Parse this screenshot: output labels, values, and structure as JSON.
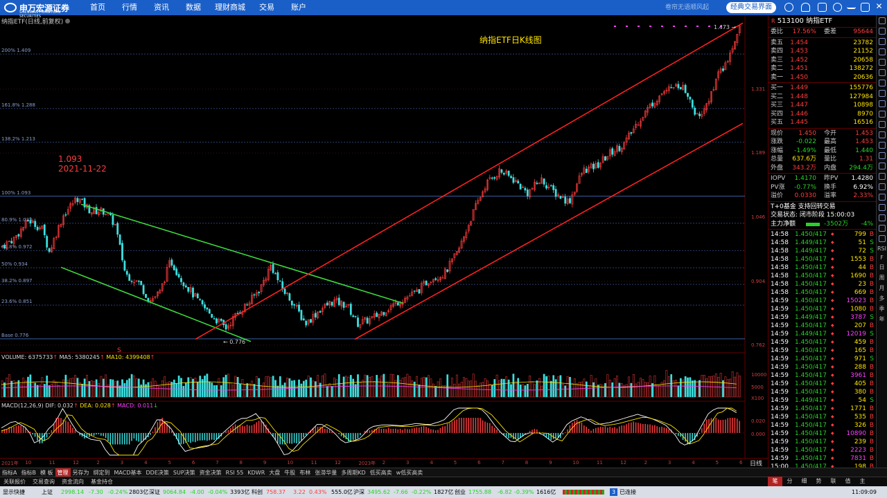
{
  "topbar": {
    "logo_cn": "申万宏源证券",
    "logo_en": "SHENWAN HONGYUAN SECURITIES",
    "nav": [
      "首页",
      "行情",
      "资讯",
      "数据",
      "理财商城",
      "交易",
      "账户"
    ],
    "news_text": "卷帘无语顺风起",
    "classic_btn": "经典交易界面"
  },
  "chart": {
    "title": "纳指ETF(日线,前复权)",
    "heading": "纳指ETF日K线图",
    "anno_price": "1.093",
    "anno_date": "2021-11-22",
    "low_label": "← 0.776",
    "high_label": "1.473 →",
    "fib_levels": [
      {
        "label": "200% 1.409",
        "price": 1.409
      },
      {
        "label": "161.8% 1.288",
        "price": 1.288
      },
      {
        "label": "138.2% 1.213",
        "price": 1.213
      },
      {
        "label": "100% 1.093",
        "price": 1.093
      },
      {
        "label": "80.9% 1.033",
        "price": 1.033
      },
      {
        "label": "61.8% 0.972",
        "price": 0.972
      },
      {
        "label": "50% 0.934",
        "price": 0.934
      },
      {
        "label": "38.2% 0.897",
        "price": 0.897
      },
      {
        "label": "23.6% 0.851",
        "price": 0.851
      },
      {
        "label": "Base 0.776",
        "price": 0.776
      }
    ],
    "price_axis": [
      "1.331",
      "1.189",
      "1.046",
      "0.904",
      "0.762"
    ],
    "volume_legend": {
      "vol": "VOLUME: 6375733",
      "ma5": "MA5: 5380245",
      "ma10": "MA10: 4399408"
    },
    "volume_axis": [
      "10000",
      "5000",
      "X100"
    ],
    "macd_legend": {
      "name": "MACD(12,26,9)",
      "dif": "DIF: 0.032",
      "dea": "DEA: 0.028",
      "macd": "MACD: 0.011"
    },
    "macd_axis": [
      "0.020",
      "0.000"
    ],
    "time_ticks": [
      "2021年",
      "10",
      "11",
      "12",
      "2",
      "3",
      "4",
      "5",
      "6",
      "7",
      "8",
      "9",
      "10",
      "11",
      "12",
      "2023年",
      "2",
      "3",
      "4",
      "5",
      "6",
      "7",
      "8",
      "9",
      "10",
      "11",
      "12",
      "2",
      "3",
      "4",
      "5",
      "6"
    ],
    "period": "日线"
  },
  "quote": {
    "code": "513100",
    "name": "纳指ETF",
    "weibi_label": "委比",
    "weibi": "17.56%",
    "weicha_label": "委差",
    "weicha": "95644",
    "asks": [
      {
        "label": "卖五",
        "price": "1.454",
        "vol": "23782"
      },
      {
        "label": "卖四",
        "price": "1.453",
        "vol": "21152"
      },
      {
        "label": "卖三",
        "price": "1.452",
        "vol": "20658"
      },
      {
        "label": "卖二",
        "price": "1.451",
        "vol": "138272"
      },
      {
        "label": "卖一",
        "price": "1.450",
        "vol": "20636"
      }
    ],
    "bids": [
      {
        "label": "买一",
        "price": "1.449",
        "vol": "155776"
      },
      {
        "label": "买二",
        "price": "1.448",
        "vol": "127984"
      },
      {
        "label": "买三",
        "price": "1.447",
        "vol": "10898"
      },
      {
        "label": "买四",
        "price": "1.446",
        "vol": "8970"
      },
      {
        "label": "买五",
        "price": "1.445",
        "vol": "16516"
      }
    ],
    "stats": [
      {
        "l1": "现价",
        "v1": "1.450",
        "c1": "red",
        "l2": "今开",
        "v2": "1.453",
        "c2": "red"
      },
      {
        "l1": "涨跌",
        "v1": "-0.022",
        "c1": "green",
        "l2": "最高",
        "v2": "1.453",
        "c2": "red"
      },
      {
        "l1": "涨幅",
        "v1": "-1.49%",
        "c1": "green",
        "l2": "最低",
        "v2": "1.440",
        "c2": "green"
      },
      {
        "l1": "总量",
        "v1": "637.6万",
        "c1": "yellow",
        "l2": "量比",
        "v2": "1.31",
        "c2": "red"
      },
      {
        "l1": "外盘",
        "v1": "343.2万",
        "c1": "red",
        "l2": "内盘",
        "v2": "294.4万",
        "c2": "green"
      }
    ],
    "iopv": [
      {
        "l1": "IOPV",
        "v1": "1.4170",
        "c1": "green",
        "l2": "昨PV",
        "v2": "1.4280",
        "c2": "white"
      },
      {
        "l1": "PV涨",
        "v1": "-0.77%",
        "c1": "green",
        "l2": "换手",
        "v2": "6.92%",
        "c2": "white"
      },
      {
        "l1": "溢价",
        "v1": "0.0330",
        "c1": "red",
        "l2": "溢率",
        "v2": "2.33%",
        "c2": "red"
      }
    ],
    "t0": "T+0基金 支持回转交易",
    "trade_status": "交易状态: 闭市阶段 15:00:03",
    "main_fund_label": "主力净额",
    "main_fund_value": "-3502万",
    "main_fund_pct": "-4%"
  },
  "ticks": [
    {
      "t": "14:58",
      "p": "1.450/417",
      "v": "799",
      "d": "B"
    },
    {
      "t": "14:58",
      "p": "1.449/417",
      "v": "51",
      "d": "S"
    },
    {
      "t": "14:58",
      "p": "1.449/417",
      "v": "72",
      "d": "S"
    },
    {
      "t": "14:58",
      "p": "1.450/417",
      "v": "1553",
      "d": "B"
    },
    {
      "t": "14:58",
      "p": "1.450/417",
      "v": "44",
      "d": "B"
    },
    {
      "t": "14:58",
      "p": "1.450/417",
      "v": "1690",
      "d": "B"
    },
    {
      "t": "14:58",
      "p": "1.450/417",
      "v": "23",
      "d": "B"
    },
    {
      "t": "14:58",
      "p": "1.450/417",
      "v": "669",
      "d": "B"
    },
    {
      "t": "14:59",
      "p": "1.450/417",
      "v": "15023",
      "d": "B"
    },
    {
      "t": "14:59",
      "p": "1.450/417",
      "v": "1080",
      "d": "B"
    },
    {
      "t": "14:59",
      "p": "1.449/417",
      "v": "3787",
      "d": "S"
    },
    {
      "t": "14:59",
      "p": "1.450/417",
      "v": "207",
      "d": "B"
    },
    {
      "t": "14:59",
      "p": "1.449/417",
      "v": "12019",
      "d": "S"
    },
    {
      "t": "14:59",
      "p": "1.450/417",
      "v": "459",
      "d": "B"
    },
    {
      "t": "14:59",
      "p": "1.450/417",
      "v": "165",
      "d": "B"
    },
    {
      "t": "14:59",
      "p": "1.450/417",
      "v": "971",
      "d": "S"
    },
    {
      "t": "14:59",
      "p": "1.450/417",
      "v": "288",
      "d": "B"
    },
    {
      "t": "14:59",
      "p": "1.450/417",
      "v": "3961",
      "d": "B"
    },
    {
      "t": "14:59",
      "p": "1.450/417",
      "v": "405",
      "d": "B"
    },
    {
      "t": "14:59",
      "p": "1.450/417",
      "v": "380",
      "d": "B"
    },
    {
      "t": "14:59",
      "p": "1.449/417",
      "v": "54",
      "d": "S"
    },
    {
      "t": "14:59",
      "p": "1.450/417",
      "v": "1771",
      "d": "B"
    },
    {
      "t": "14:59",
      "p": "1.450/417",
      "v": "535",
      "d": "B"
    },
    {
      "t": "14:59",
      "p": "1.450/417",
      "v": "326",
      "d": "B"
    },
    {
      "t": "14:59",
      "p": "1.450/417",
      "v": "10890",
      "d": "B"
    },
    {
      "t": "14:59",
      "p": "1.450/417",
      "v": "239",
      "d": "B"
    },
    {
      "t": "14:59",
      "p": "1.450/417",
      "v": "2223",
      "d": "B"
    },
    {
      "t": "14:59",
      "p": "1.450/417",
      "v": "7831",
      "d": "B"
    },
    {
      "t": "15:00",
      "p": "1.450/417",
      "v": "198",
      "d": "B"
    }
  ],
  "tabs1": [
    "指标A",
    "指标B",
    "模 板",
    "管理",
    "另存为",
    "绑定到",
    "MACD基本",
    "DDE决策",
    "SUP决策",
    "资金决策",
    "RSI 55",
    "KDWR",
    "大盘",
    "牛股",
    "布林",
    "张滞华量",
    "多周期KD",
    "低买高卖",
    "w低买高卖"
  ],
  "tabs1_active": "管理",
  "tabs2": [
    "关联报价",
    "交易查询",
    "资金流向",
    "基金持仓"
  ],
  "rtabs": [
    "笔",
    "分",
    "细",
    "势",
    "联",
    "值",
    "主"
  ],
  "rtabs_active": "笔",
  "icon_labels": [
    "RSI",
    "F",
    "日",
    "周",
    "月",
    "多",
    "季",
    "年"
  ],
  "status": {
    "show_label": "显示快捷",
    "sh_label": "上证",
    "sh": "2998.14",
    "sh_chg": "-7.30",
    "sh_pct": "-0.24%",
    "sh_amt": "2803亿",
    "sz_label": "深证",
    "sz": "9064.84",
    "sz_chg": "-4.00",
    "sz_pct": "-0.04%",
    "sz_amt": "3393亿",
    "kc_label": "科创",
    "kc": "758.37",
    "kc_chg": "3.22",
    "kc_pct": "0.43%",
    "kc_amt": "555.0亿",
    "hs_label": "沪深",
    "hs": "3495.62",
    "hs_chg": "-7.66",
    "hs_pct": "-0.22%",
    "hs_amt": "1827亿",
    "cy_label": "创业",
    "cy": "1755.88",
    "cy_chg": "-6.82",
    "cy_pct": "-0.39%",
    "cy_amt": "1616亿",
    "conn_num": "3",
    "conn_label": "已连接",
    "time": "11:09:09"
  },
  "chart_data": {
    "type": "candlestick",
    "title": "纳指ETF日K线图",
    "ylim": [
      0.762,
      1.473
    ],
    "close_path": [
      [
        0,
        0.98
      ],
      [
        20,
        1.0
      ],
      [
        40,
        1.04
      ],
      [
        60,
        1.02
      ],
      [
        70,
        0.97
      ],
      [
        90,
        1.05
      ],
      [
        110,
        1.09
      ],
      [
        130,
        1.06
      ],
      [
        150,
        1.06
      ],
      [
        165,
        1.03
      ],
      [
        180,
        0.92
      ],
      [
        200,
        0.9
      ],
      [
        215,
        0.86
      ],
      [
        230,
        0.88
      ],
      [
        245,
        0.95
      ],
      [
        260,
        0.91
      ],
      [
        275,
        0.88
      ],
      [
        290,
        0.85
      ],
      [
        310,
        0.82
      ],
      [
        325,
        0.8
      ],
      [
        340,
        0.83
      ],
      [
        360,
        0.86
      ],
      [
        375,
        0.89
      ],
      [
        390,
        0.94
      ],
      [
        405,
        0.89
      ],
      [
        420,
        0.86
      ],
      [
        440,
        0.81
      ],
      [
        460,
        0.84
      ],
      [
        480,
        0.86
      ],
      [
        500,
        0.85
      ],
      [
        515,
        0.81
      ],
      [
        535,
        0.82
      ],
      [
        555,
        0.84
      ],
      [
        575,
        0.86
      ],
      [
        600,
        0.88
      ],
      [
        620,
        0.91
      ],
      [
        640,
        0.92
      ],
      [
        660,
        0.97
      ],
      [
        680,
        1.05
      ],
      [
        700,
        1.12
      ],
      [
        720,
        1.15
      ],
      [
        740,
        1.13
      ],
      [
        760,
        1.1
      ],
      [
        780,
        1.13
      ],
      [
        800,
        1.1
      ],
      [
        820,
        1.08
      ],
      [
        840,
        1.15
      ],
      [
        860,
        1.16
      ],
      [
        880,
        1.19
      ],
      [
        900,
        1.21
      ],
      [
        920,
        1.26
      ],
      [
        940,
        1.3
      ],
      [
        960,
        1.33
      ],
      [
        980,
        1.34
      ],
      [
        995,
        1.31
      ],
      [
        1005,
        1.27
      ],
      [
        1020,
        1.3
      ],
      [
        1035,
        1.36
      ],
      [
        1050,
        1.39
      ],
      [
        1062,
        1.45
      ],
      [
        1068,
        1.473
      ]
    ],
    "volume_ylim": [
      0,
      12000
    ],
    "macd_ylim": [
      -0.03,
      0.04
    ]
  }
}
